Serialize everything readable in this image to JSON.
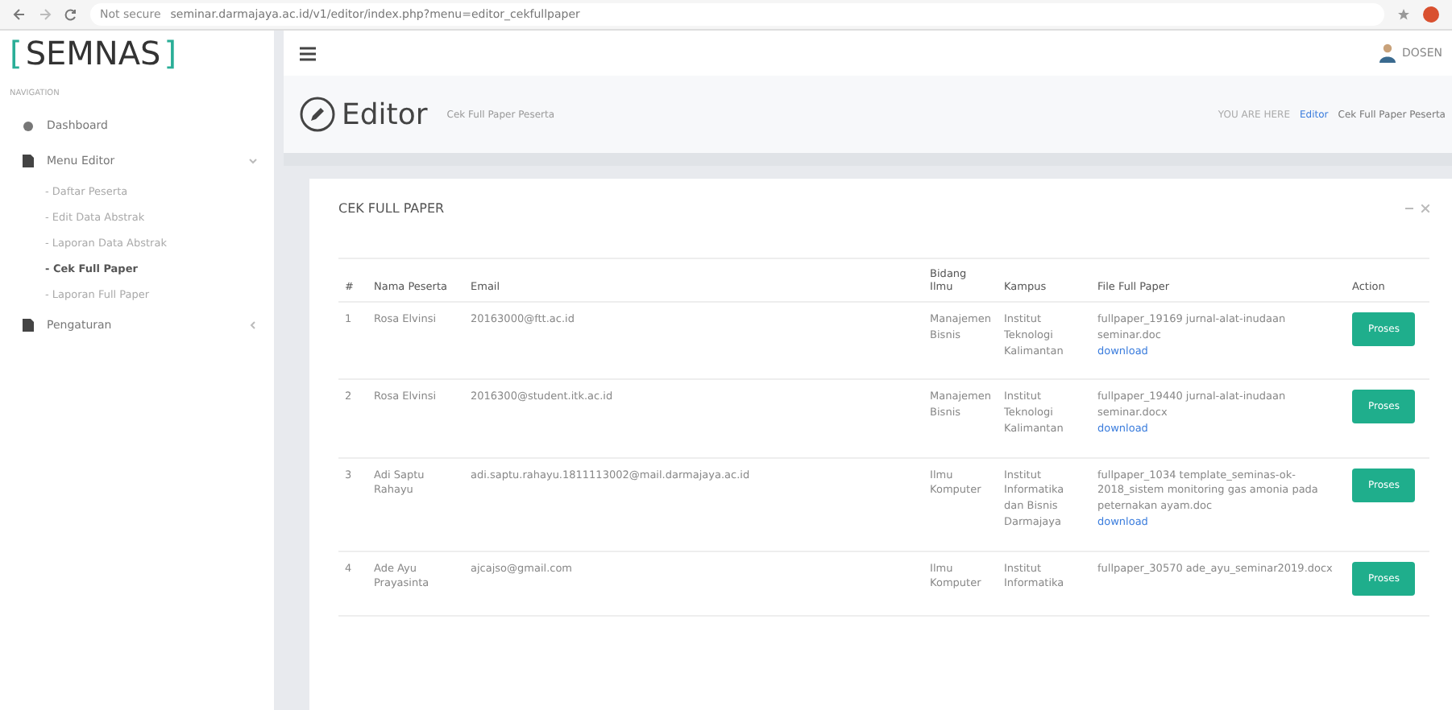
{
  "browser": {
    "security": "Not secure",
    "url": "seminar.darmajaya.ac.id/v1/editor/index.php?menu=editor_cekfullpaper"
  },
  "brand": {
    "open": "[",
    "name": "SEMNAS",
    "close": "]"
  },
  "sidebar": {
    "heading": "NAVIGATION",
    "items": [
      {
        "label": "Dashboard",
        "kind": "top"
      },
      {
        "label": "Menu Editor",
        "kind": "group",
        "expanded": true,
        "children": [
          {
            "label": "- Daftar Peserta",
            "selected": false
          },
          {
            "label": "- Edit Data Abstrak",
            "selected": false
          },
          {
            "label": "- Laporan Data Abstrak",
            "selected": false
          },
          {
            "label": "- Cek Full Paper",
            "selected": true
          },
          {
            "label": "- Laporan Full Paper",
            "selected": false
          }
        ]
      },
      {
        "label": "Pengaturan",
        "kind": "group",
        "expanded": false
      }
    ]
  },
  "header": {
    "user": "DOSEN"
  },
  "page": {
    "title": "Editor",
    "subtitle": "Cek Full Paper Peserta",
    "breadcrumb": {
      "prefix": "YOU ARE HERE",
      "items": [
        "Editor",
        "Cek Full Paper Peserta"
      ]
    }
  },
  "card": {
    "title": "CEK FULL PAPER",
    "columns": [
      "#",
      "Nama Peserta",
      "Email",
      "Bidang Ilmu",
      "Kampus",
      "File Full Paper",
      "Action"
    ],
    "rows": [
      {
        "no": "1",
        "nama": "Rosa Elvinsi",
        "email": "20163000@ftt.ac.id",
        "bidang": "Manajemen Bisnis",
        "kampus": "Institut Teknologi Kalimantan",
        "file": "fullpaper_19169 jurnal-alat-inudaan seminar.doc",
        "link": "download",
        "action": "Proses"
      },
      {
        "no": "2",
        "nama": "Rosa Elvinsi",
        "email": "2016300@student.itk.ac.id",
        "bidang": "Manajemen Bisnis",
        "kampus": "Institut Teknologi Kalimantan",
        "file": "fullpaper_19440 jurnal-alat-inudaan seminar.docx",
        "link": "download",
        "action": "Proses"
      },
      {
        "no": "3",
        "nama": "Adi Saptu Rahayu",
        "email": "adi.saptu.rahayu.1811113002@mail.darmajaya.ac.id",
        "bidang": "Ilmu Komputer",
        "kampus": "Institut Informatika dan Bisnis Darmajaya",
        "file": "fullpaper_1034 template_seminas-ok-2018_sistem monitoring gas amonia pada peternakan ayam.doc",
        "link": "download",
        "action": "Proses"
      },
      {
        "no": "4",
        "nama": "Ade Ayu Prayasinta",
        "email": "ajcajso@gmail.com",
        "bidang": "Ilmu Komputer",
        "kampus": "Institut Informatika",
        "file": "fullpaper_30570 ade_ayu_seminar2019.docx",
        "action": "Proses"
      }
    ]
  }
}
